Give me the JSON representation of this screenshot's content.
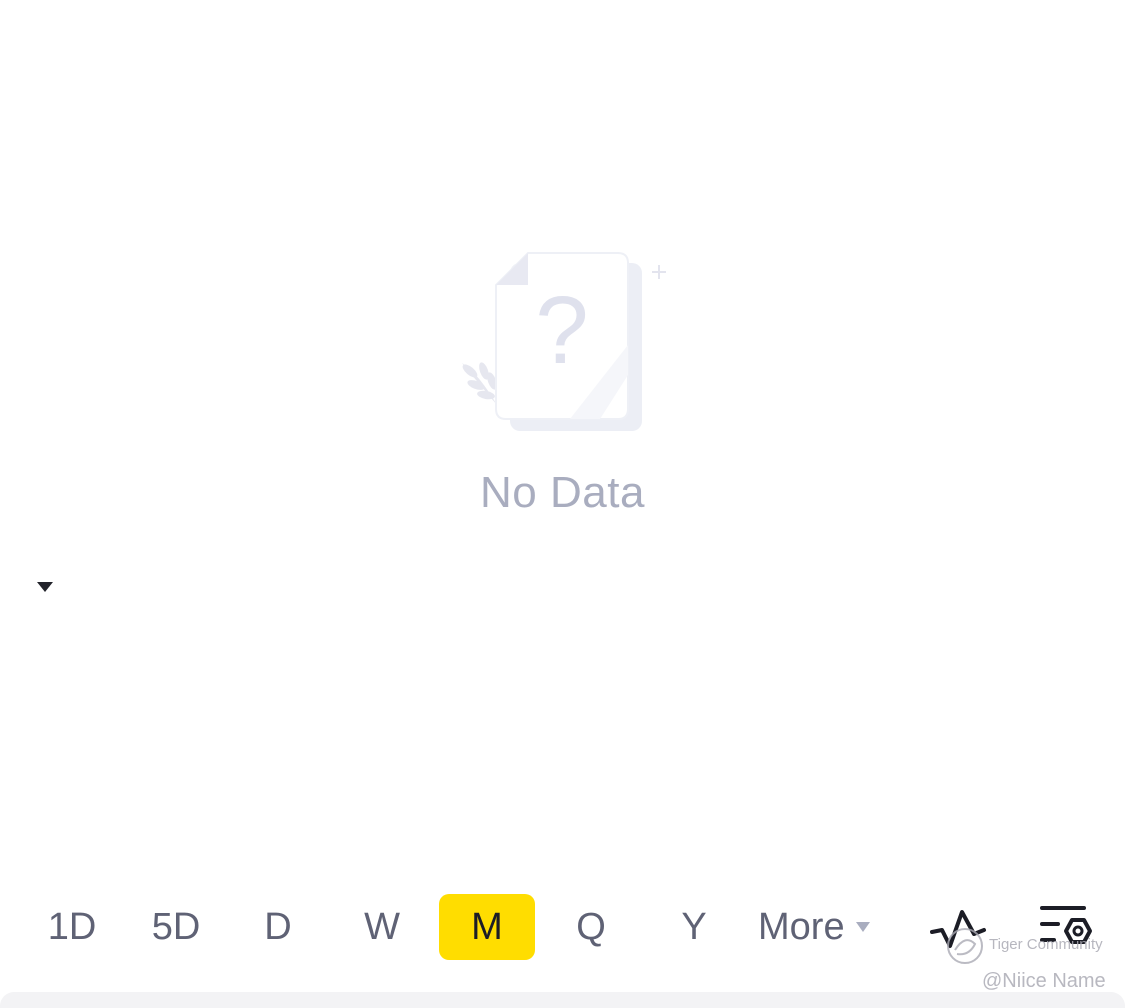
{
  "empty_state": {
    "message": "No Data",
    "illustration": "no-data-document-icon"
  },
  "periods": {
    "items": [
      {
        "label": "1D",
        "active": false
      },
      {
        "label": "5D",
        "active": false
      },
      {
        "label": "D",
        "active": false
      },
      {
        "label": "W",
        "active": false
      },
      {
        "label": "M",
        "active": true
      },
      {
        "label": "Q",
        "active": false
      },
      {
        "label": "Y",
        "active": false
      }
    ],
    "more_label": "More",
    "active_color": "#ffdd00"
  },
  "tools": {
    "indicator_icon": "indicator-wave-icon",
    "settings_icon": "chart-settings-icon"
  },
  "watermark": {
    "brand": "Tiger Community",
    "handle": "@Niice Name"
  }
}
